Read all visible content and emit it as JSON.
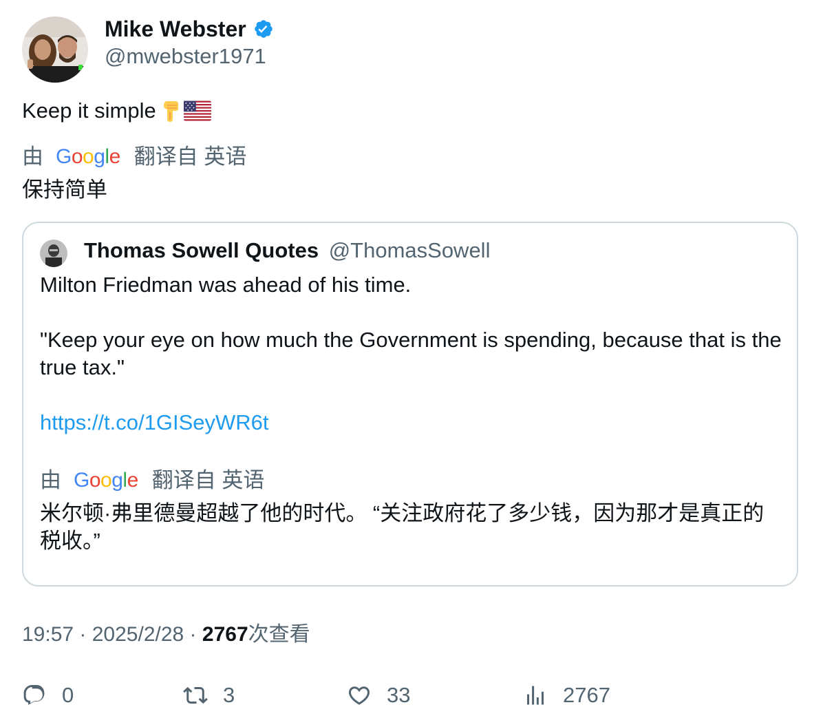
{
  "author": {
    "name": "Mike Webster",
    "handle": "@mwebster1971",
    "verified": true
  },
  "tweet": {
    "text": "Keep it simple",
    "emojis": [
      "backhand-index-pointing-down",
      "flag-us"
    ]
  },
  "translation": {
    "prefix": "由",
    "provider": "Google",
    "suffix": "翻译自 英语",
    "text": "保持简单"
  },
  "quote": {
    "author_name": "Thomas Sowell Quotes",
    "author_handle": "@ThomasSowell",
    "line1": "Milton Friedman was ahead of his time.",
    "line2": "\"Keep your eye on how much the Government is spending, because that is the true tax.\"",
    "link": "https://t.co/1GISeyWR6t",
    "translation": {
      "prefix": "由",
      "provider": "Google",
      "suffix": "翻译自 英语",
      "text": "米尔顿·弗里德曼超越了他的时代。 “关注政府花了多少钱，因为那才是真正的税收。”"
    }
  },
  "meta": {
    "time": "19:57",
    "separator": " · ",
    "date": "2025/2/28",
    "views_count": "2767",
    "views_label": "次查看"
  },
  "actions": {
    "replies": "0",
    "retweets": "3",
    "likes": "33",
    "views": "2767"
  },
  "colors": {
    "text": "#0f1419",
    "secondary": "#536471",
    "link": "#1d9bf0",
    "border": "#cfd9de",
    "verified": "#1d9bf0"
  }
}
